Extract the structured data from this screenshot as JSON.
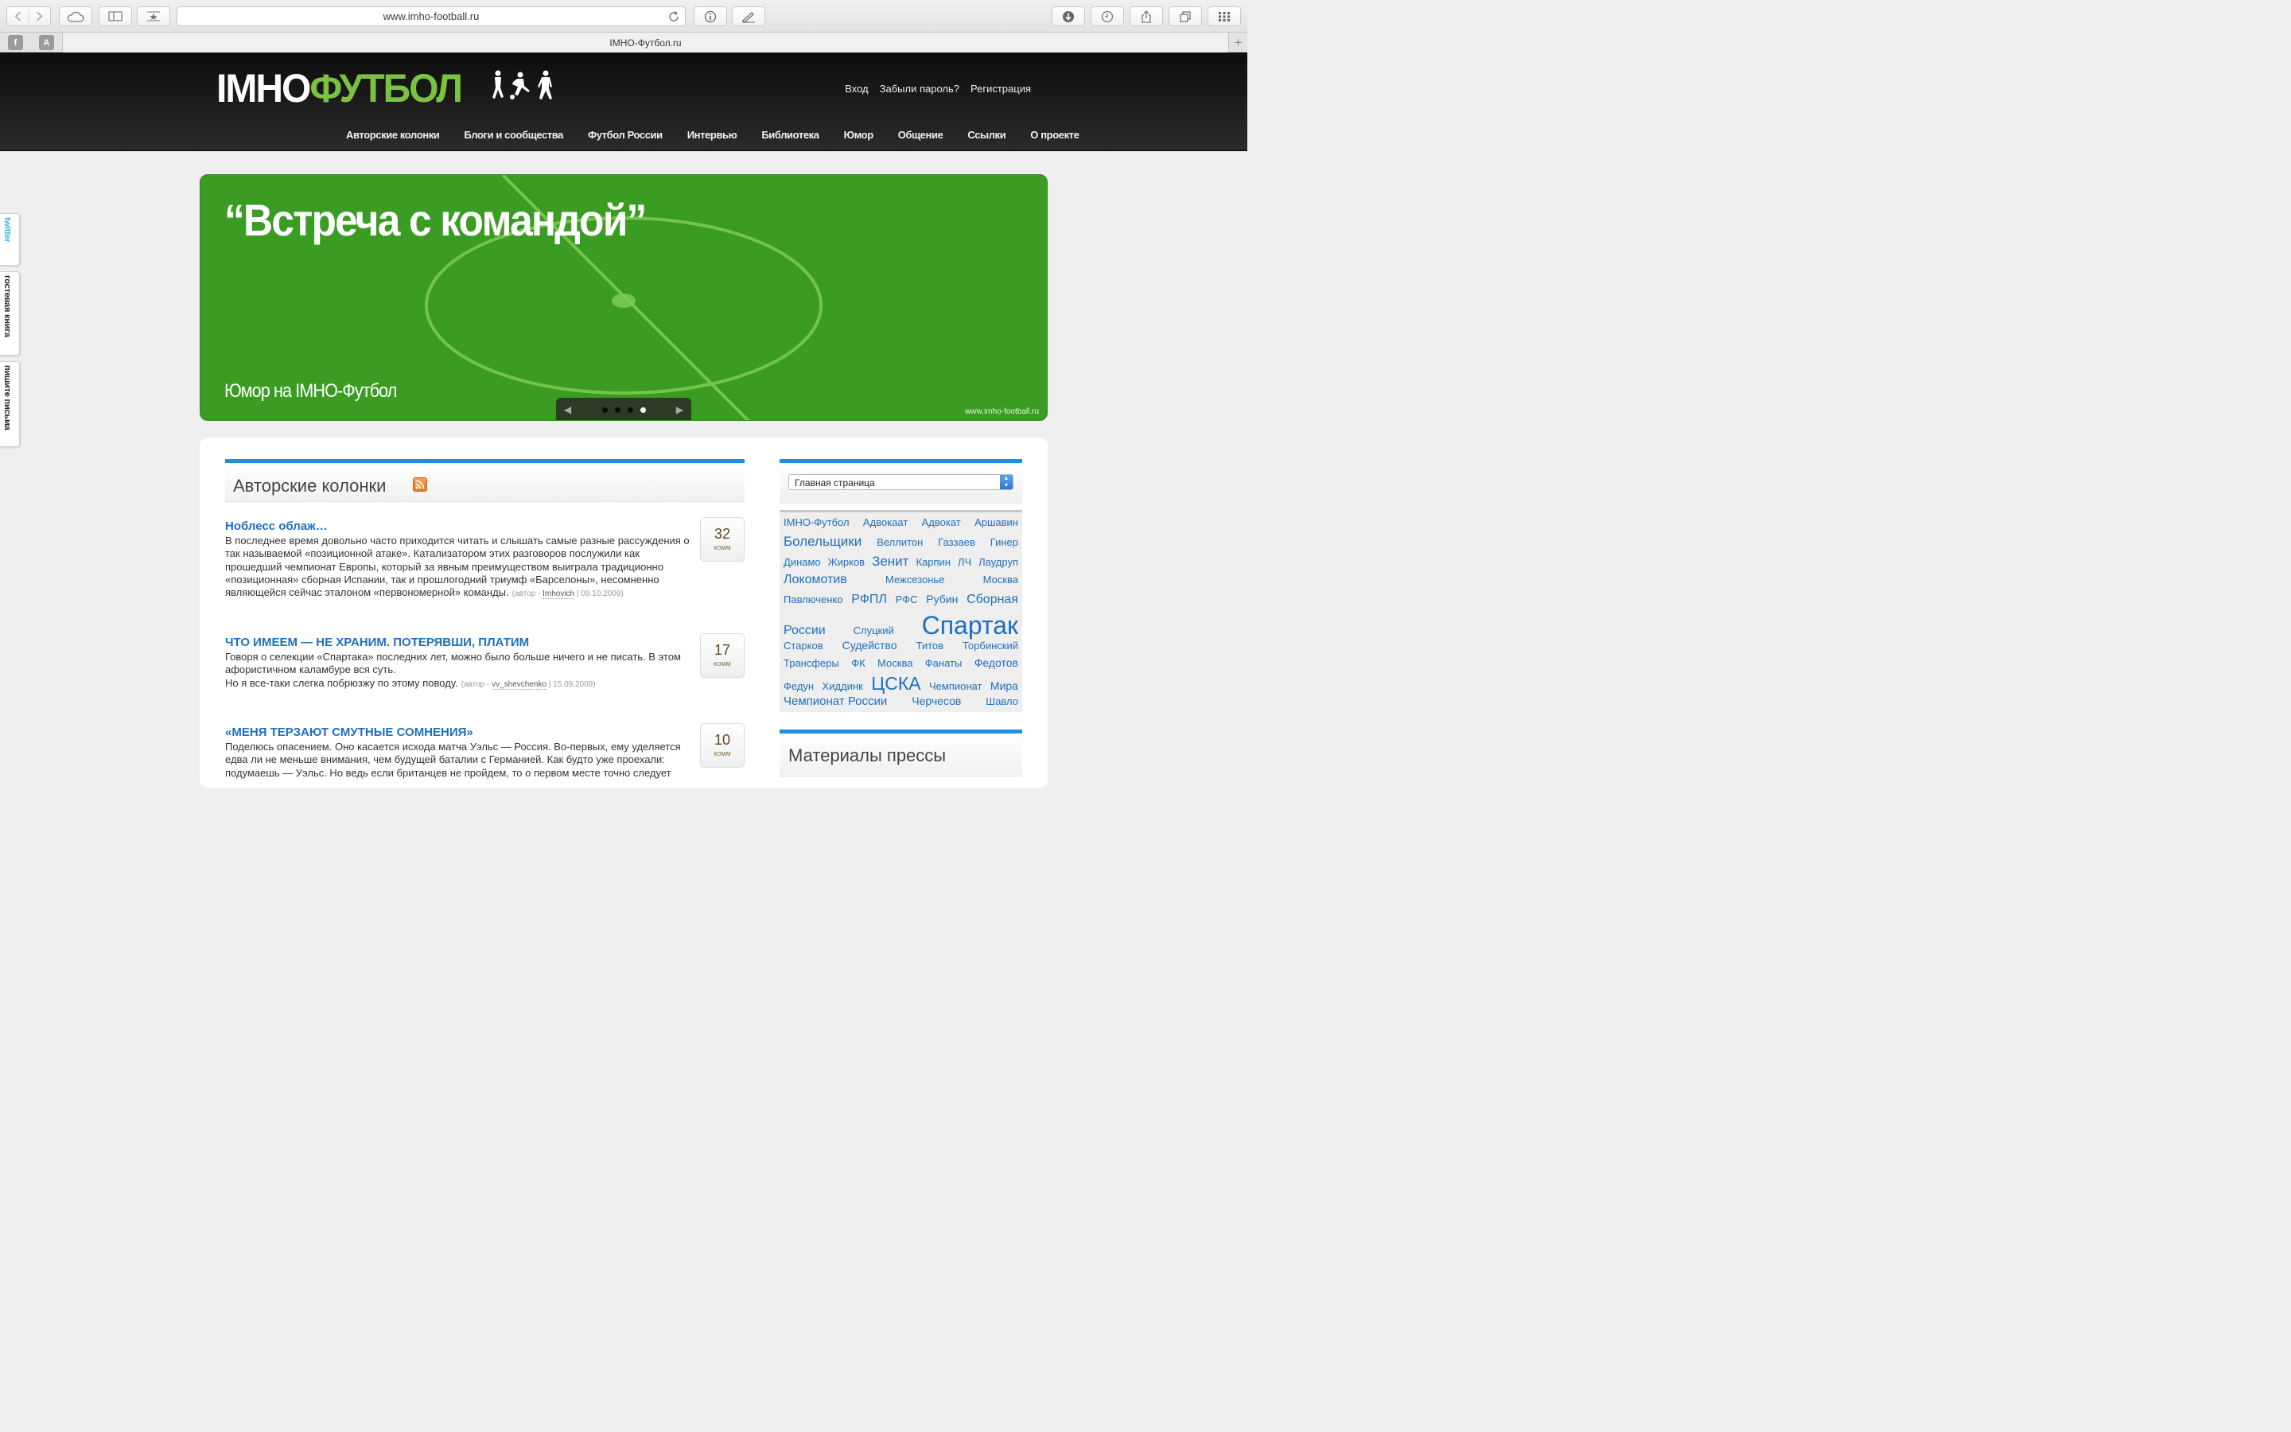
{
  "browser": {
    "url": "www.imho-football.ru",
    "tab_title": "IMHO-Футбол.ru",
    "pinned_tabs": [
      "f",
      "A"
    ],
    "new_tab": "+"
  },
  "site": {
    "logo_left": "IMHO",
    "logo_right": "ФУТБОЛ",
    "auth": {
      "login": "Вход",
      "forgot": "Забыли пароль?",
      "register": "Регистрация"
    },
    "nav": [
      "Авторские колонки",
      "Блоги и сообщества",
      "Футбол России",
      "Интервью",
      "Библиотека",
      "Юмор",
      "Общение",
      "Ссылки",
      "О проекте"
    ],
    "side_tabs": [
      "twitter",
      "гостевая книга",
      "пишите письма"
    ]
  },
  "banner": {
    "title": "“Встреча с командой”",
    "subtitle": "Юмор на IMHO-Футбол",
    "url": "www.imho-football.ru",
    "slides": 4,
    "active_slide": 4,
    "prev": "◀",
    "next": "▶"
  },
  "columns": {
    "title": "Авторские колонки",
    "articles": [
      {
        "title": "Ноблесс облаж…",
        "text": "В последнее время довольно часто приходится читать и слышать самые разные рассуждения о так называемой «позиционной атаке». Катализатором этих разговоров послужили как прошедший чемпионат Европы, который за явным преимуществом выиграла традиционно «позиционная» сборная Испании, так и прошлогодний триумф «Барселоны», несомненно являющейся сейчас эталоном «первономерной» команды.",
        "meta_prefix": "(автор - ",
        "author": "Imhovich",
        "meta_suffix": " | 09.10.2009)",
        "comments": "32",
        "comments_label": "комм"
      },
      {
        "title": "ЧТО ИМЕЕМ — НЕ ХРАНИМ. ПОТЕРЯВШИ, ПЛАТИМ",
        "text": "Говоря о селекции «Спартака» последних лет, можно было больше ничего и не писать. В этом афористичном каламбуре вся суть.",
        "text2": "Но я все-таки слегка побрюзжу по этому поводу.",
        "meta_prefix": "(автор - ",
        "author": "vv_shevchenko",
        "meta_suffix": " | 15.09.2009)",
        "comments": "17",
        "comments_label": "комм"
      },
      {
        "title": "«МЕНЯ ТЕРЗАЮТ СМУТНЫЕ СОМНЕНИЯ»",
        "text": "Поделюсь опасением. Оно касается исхода матча Уэльс — Россия. Во-первых, ему уделяется едва ли не меньше внимания, чем будущей баталии с Германией. Как будто уже проехали: подумаешь — Уэльс. Но ведь если британцев не пройдем, то о первом месте точно следует",
        "comments": "10",
        "comments_label": "комм"
      }
    ]
  },
  "sidebar": {
    "select_value": "Главная страница",
    "tag_lines": [
      [
        [
          "IMHO-Футбол",
          13
        ],
        [
          "Адвокаат",
          13
        ],
        [
          "Адвокат",
          13
        ],
        [
          "Аршавин",
          13
        ]
      ],
      [
        [
          "Болельщики",
          17
        ],
        [
          "Веллитон",
          13
        ],
        [
          "Газзаев",
          13
        ],
        [
          "Гинер",
          13
        ]
      ],
      [
        [
          "Динамо",
          13
        ],
        [
          "Жирков",
          13
        ],
        [
          "Зенит",
          17
        ],
        [
          "Карпин",
          13
        ],
        [
          "ЛЧ",
          13
        ],
        [
          "Лаудруп",
          13
        ]
      ],
      [
        [
          "Локомотив",
          16
        ],
        [
          "Межсезонье",
          13
        ],
        [
          "Москва",
          13
        ]
      ],
      [
        [
          "Павлюченко",
          13
        ],
        [
          "РФПЛ",
          16
        ],
        [
          "РФС",
          13
        ],
        [
          "Рубин",
          14
        ],
        [
          "Сборная",
          16
        ]
      ],
      [
        [
          "России",
          16
        ],
        [
          "Слуцкий",
          13
        ],
        [
          "Спартак",
          32
        ]
      ],
      [
        [
          "Старков",
          13
        ],
        [
          "Судейство",
          14
        ],
        [
          "Титов",
          13
        ],
        [
          "Торбинский",
          13
        ]
      ],
      [
        [
          "Трансферы",
          13
        ],
        [
          "ФК",
          13
        ],
        [
          "Москва",
          13
        ],
        [
          "Фанаты",
          13
        ],
        [
          "Федотов",
          14
        ]
      ],
      [
        [
          "Федун",
          13
        ],
        [
          "Хиддинк",
          13
        ],
        [
          "ЦСКА",
          23
        ],
        [
          "Чемпионат",
          13
        ],
        [
          "Мира",
          14
        ]
      ],
      [
        [
          "Чемпионат России",
          15
        ],
        [
          "Черчесов",
          14
        ],
        [
          "Шавло",
          13
        ]
      ]
    ],
    "press_title": "Материалы прессы"
  }
}
